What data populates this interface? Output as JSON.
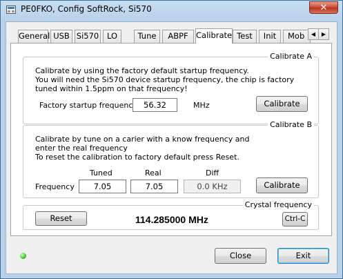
{
  "window": {
    "title": "PE0FKO, Config SoftRock, Si570",
    "close_glyph": "✕"
  },
  "tabs": [
    {
      "label": "General"
    },
    {
      "label": "USB"
    },
    {
      "label": "Si570"
    },
    {
      "label": "LO"
    },
    {
      "label": "Tune"
    },
    {
      "label": "ABPF"
    },
    {
      "label": "Calibrate",
      "active": true
    },
    {
      "label": "Test"
    },
    {
      "label": "Init"
    },
    {
      "label": "Mob"
    }
  ],
  "tab_scroll": {
    "left": "◀",
    "right": "▶"
  },
  "calibrate_a": {
    "title": "Calibrate  A",
    "line1": "Calibrate by using the factory default startup frequency.",
    "line2": "You will need the Si570 device startup frequency, the chip is factory tuned within 1.5ppm on that frequency!",
    "field_label": "Factory startup frequency",
    "field_value": "56.32",
    "unit": "MHz",
    "button": "Calibrate"
  },
  "calibrate_b": {
    "title": "Calibrate  B",
    "line1": "Calibrate by tune on a carier with a know frequency and enter the real frequency",
    "line2": "To reset the calibration to factory default press Reset.",
    "col_tuned": "Tuned",
    "col_real": "Real",
    "col_diff": "Diff",
    "row_label": "Frequency",
    "tuned_value": "7.05",
    "real_value": "7.05",
    "diff_value": "0.0 KHz",
    "button": "Calibrate"
  },
  "crystal": {
    "title": "Crystal frequency",
    "reset_button": "Reset",
    "frequency": "114.285000 MHz",
    "copy_button": "Ctrl-C"
  },
  "footer": {
    "status_color": "#3fd02c",
    "close_button": "Close",
    "exit_button": "Exit"
  }
}
